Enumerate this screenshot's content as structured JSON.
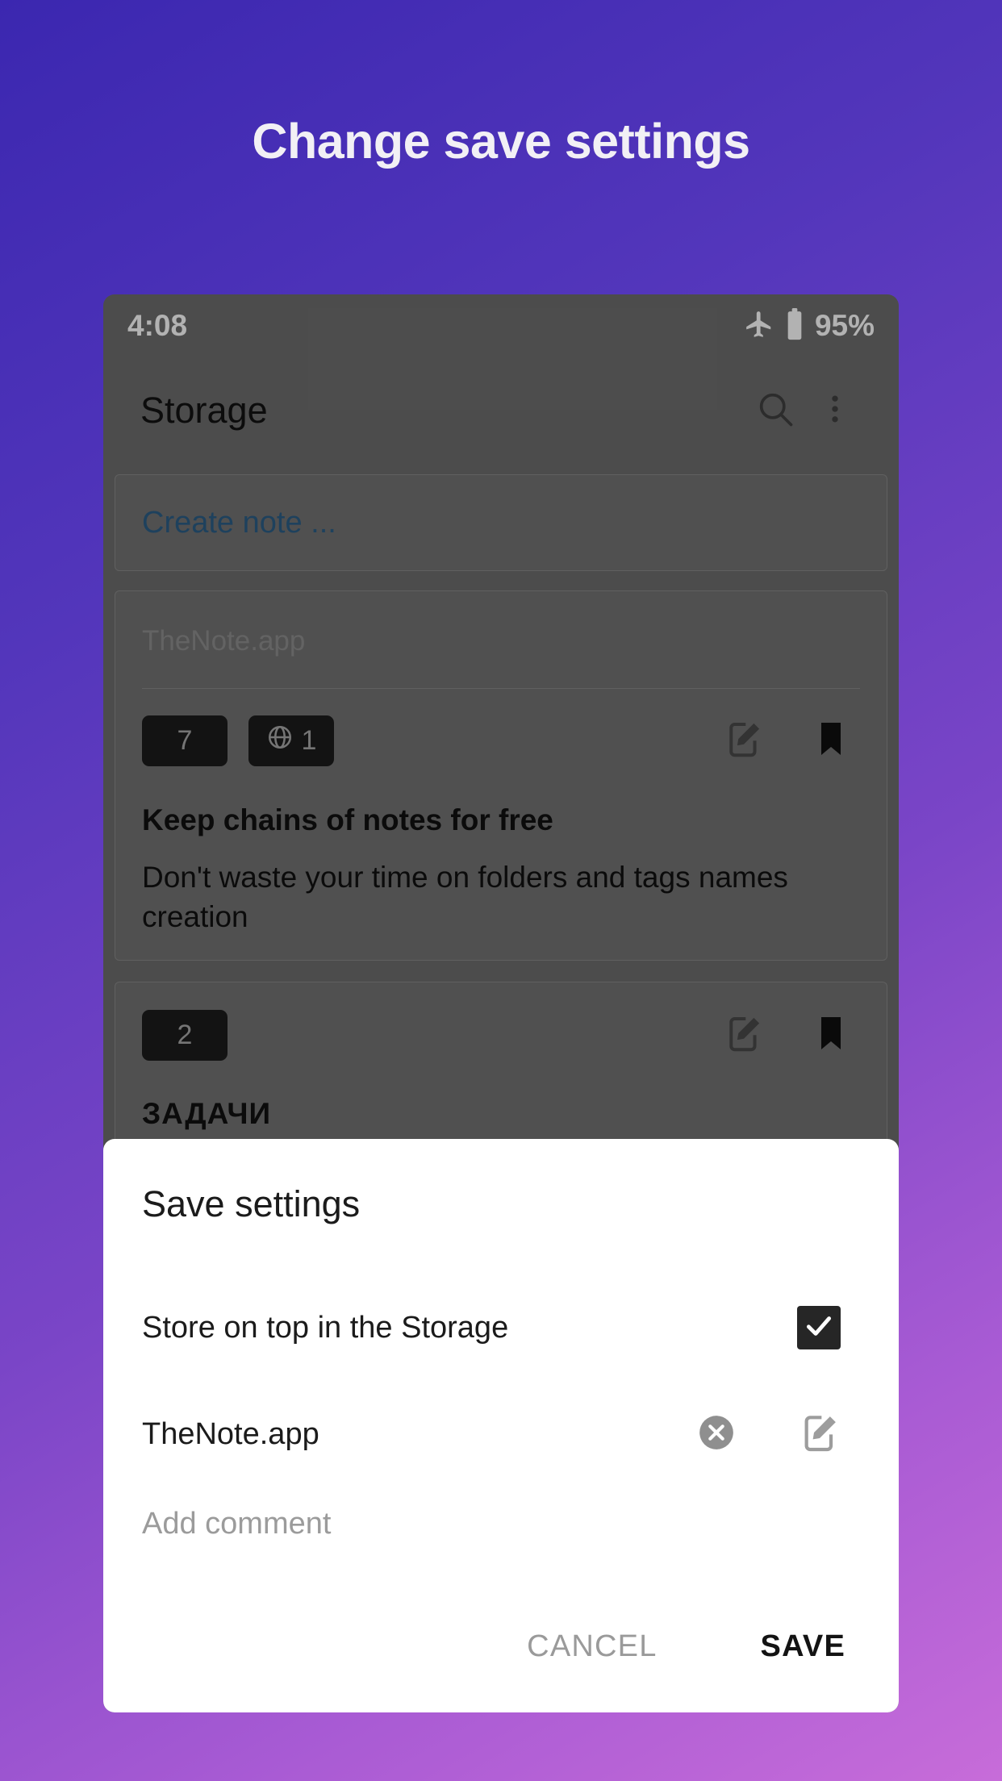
{
  "promo": {
    "title": "Change save settings"
  },
  "theme": {
    "gradient_start": "#3b27b0",
    "gradient_end": "#c76cd9",
    "phone_surface": "#6e6e6e",
    "dialog_surface": "#ffffff",
    "link_blue": "#2c5d86",
    "badge_dark": "#1c1c1c"
  },
  "status_bar": {
    "time": "4:08",
    "airplane_icon": "airplane-mode-icon",
    "battery_icon": "battery-icon",
    "battery_percent": "95%"
  },
  "app_bar": {
    "title": "Storage",
    "search_icon": "search-icon",
    "overflow_icon": "more-vertical-icon"
  },
  "content": {
    "create_note_placeholder": "Create note ...",
    "notes": [
      {
        "source": "TheNote.app",
        "count_badge": "7",
        "web_badge": "1",
        "web_badge_icon": "globe-icon",
        "edit_icon": "edit-note-icon",
        "bookmark_icon": "bookmark-icon",
        "title": "Keep chains of notes for free",
        "body": "Don't waste your time on folders and tags names creation"
      },
      {
        "count_badge": "2",
        "edit_icon": "edit-note-icon",
        "bookmark_icon": "bookmark-icon",
        "title": "ЗАДАЧИ"
      }
    ]
  },
  "dialog": {
    "title": "Save settings",
    "store_on_top_label": "Store on top in the Storage",
    "store_on_top_checked": true,
    "checkbox_icon": "checkmark-icon",
    "source_value": "TheNote.app",
    "clear_icon": "clear-circle-icon",
    "edit_icon": "edit-note-icon",
    "comment_placeholder": "Add comment",
    "cancel_label": "CANCEL",
    "save_label": "SAVE"
  }
}
